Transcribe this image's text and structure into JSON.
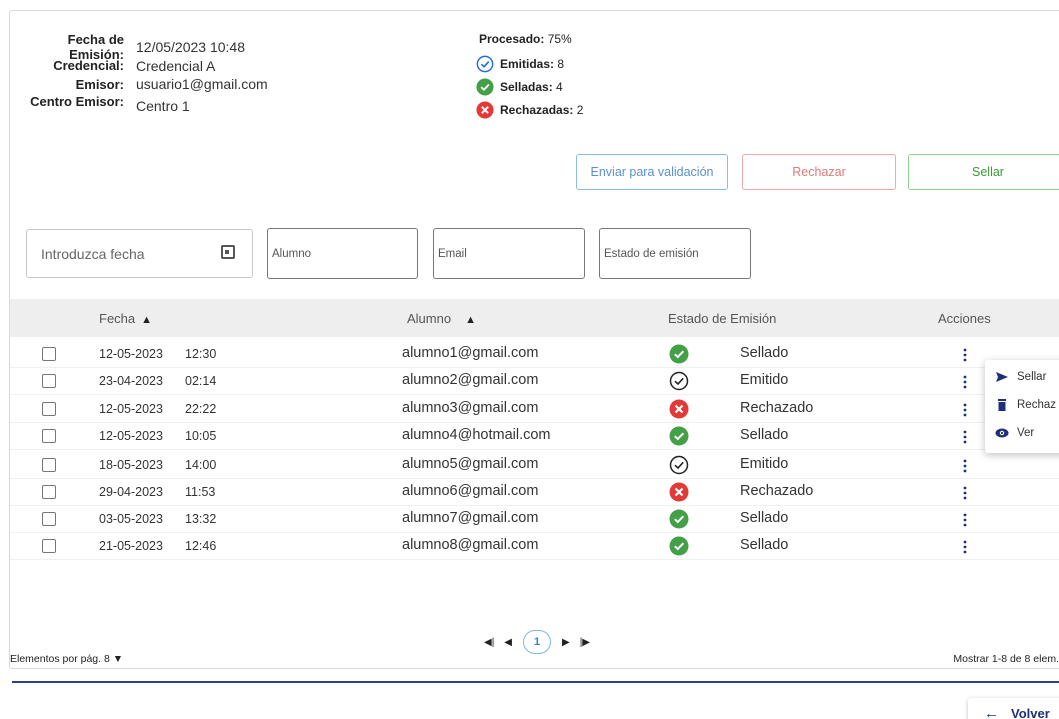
{
  "info": {
    "fecha_label": "Fecha de Emisión:",
    "fecha_value": "12/05/2023 10:48",
    "credencial_label": "Credencial:",
    "credencial_value": "Credencial A",
    "emisor_label": "Emisor:",
    "emisor_value": "usuario1@gmail.com",
    "centro_label": "Centro Emisor:",
    "centro_value": "Centro 1"
  },
  "stats": {
    "procesado_label": "Procesado:",
    "procesado_value": "75%",
    "emitidas_label": "Emitidas:",
    "emitidas_value": "8",
    "selladas_label": "Selladas:",
    "selladas_value": "4",
    "rechazadas_label": "Rechazadas:",
    "rechazadas_value": "2"
  },
  "actions": {
    "validar": "Enviar para validación",
    "rechazar": "Rechazar",
    "sellar": "Sellar"
  },
  "filters": {
    "fecha_placeholder": "Introduzca fecha",
    "alumno_placeholder": "Alumno",
    "email_placeholder": "Email",
    "estado_placeholder": "Estado de emisión"
  },
  "table": {
    "headers": {
      "fecha": "Fecha",
      "alumno": "Alumno",
      "estado": "Estado de Emisión",
      "acciones": "Acciones"
    },
    "rows": [
      {
        "fecha": "12-05-2023",
        "hora": "12:30",
        "email": "alumno1@gmail.com",
        "estado": "Sellado",
        "icon": "sellado-icon"
      },
      {
        "fecha": "23-04-2023",
        "hora": "02:14",
        "email": "alumno2@gmail.com",
        "estado": "Emitido",
        "icon": "emitido-icon"
      },
      {
        "fecha": "12-05-2023",
        "hora": "22:22",
        "email": "alumno3@gmail.com",
        "estado": "Rechazado",
        "icon": "rechazado-icon"
      },
      {
        "fecha": "12-05-2023",
        "hora": "10:05",
        "email": "alumno4@hotmail.com",
        "estado": "Sellado",
        "icon": "sellado-icon"
      },
      {
        "fecha": "18-05-2023",
        "hora": "14:00",
        "email": "alumno5@gmail.com",
        "estado": "Emitido",
        "icon": "emitido-icon"
      },
      {
        "fecha": "29-04-2023",
        "hora": "11:53",
        "email": "alumno6@gmail.com",
        "estado": "Rechazado",
        "icon": "rechazado-icon"
      },
      {
        "fecha": "03-05-2023",
        "hora": "13:32",
        "email": "alumno7@gmail.com",
        "estado": "Sellado",
        "icon": "sellado-icon"
      },
      {
        "fecha": "21-05-2023",
        "hora": "12:46",
        "email": "alumno8@gmail.com",
        "estado": "Sellado",
        "icon": "sellado-icon"
      }
    ]
  },
  "context_menu": {
    "sellar": "Sellar",
    "rechazar": "Rechaz",
    "ver": "Ver"
  },
  "footer": {
    "per_page_label": "Elementos por pág.",
    "per_page_value": "8",
    "current_page": "1",
    "showing": "Mostrar 1-8 de 8 elem."
  },
  "volver": "Volver",
  "colors": {
    "sellado": "#43a047",
    "rechazado": "#e53935",
    "emitido_stat": "#1e6fd9",
    "nav_blue": "#2a3f8f"
  }
}
